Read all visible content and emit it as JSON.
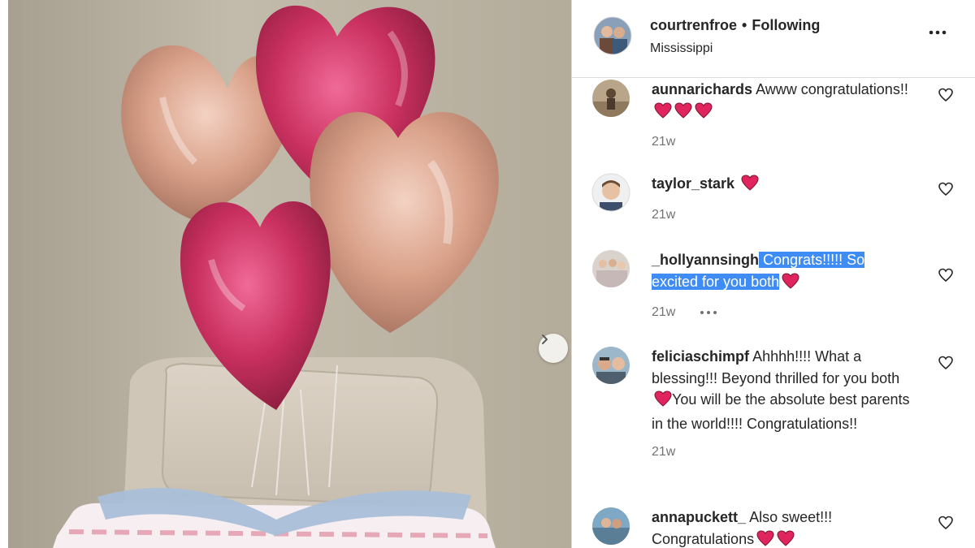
{
  "post": {
    "username": "courtrenfroe",
    "separator": "•",
    "follow_status": "Following",
    "location": "Mississippi"
  },
  "icons": {
    "more": "more-horizontal-icon",
    "next": "chevron-right-icon",
    "like": "heart-outline-icon",
    "emoji": "red-heart-emoji"
  },
  "comments": [
    {
      "username": "aunnarichards",
      "text": "Awww congratulations!!",
      "hearts": 3,
      "time": "21w"
    },
    {
      "username": "taylor_stark",
      "text": "",
      "hearts": 1,
      "time": "21w"
    },
    {
      "username": "_hollyannsingh",
      "text": "Congrats!!!!! So excited for you both",
      "hearts": 1,
      "time": "21w",
      "highlighted": true
    },
    {
      "username": "feliciaschimpf",
      "text_before": "Ahhhh!!!! What a blessing!!! Beyond thrilled for you both",
      "text_after": "You will be the absolute best parents in the world!!!! Congratulations!!",
      "time": "21w"
    },
    {
      "username": "annapuckett_",
      "text": "Also sweet!!! Congratulations",
      "hearts": 2,
      "time": ""
    }
  ],
  "colors": {
    "heart_red": "#e0245e",
    "highlight": "#3f8df4",
    "muted_text": "#737373"
  }
}
